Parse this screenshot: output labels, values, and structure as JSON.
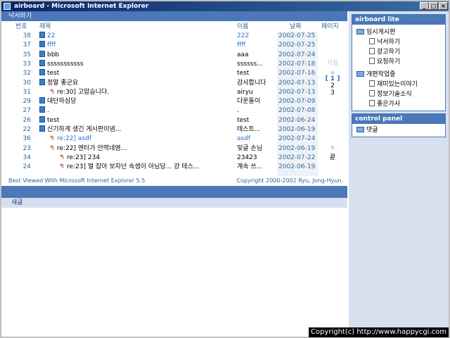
{
  "window": {
    "title": "airboard - Microsoft Internet Explorer"
  },
  "titlebar": {
    "min": "_",
    "max": "□",
    "close": "×"
  },
  "board": {
    "header": "낙서하기",
    "columns": {
      "num": "번호",
      "subject": "제목",
      "author": "이름",
      "date": "날짜",
      "page": "페이지"
    },
    "rows": [
      {
        "num": "38",
        "subject": "22",
        "author": "222",
        "date": "2002-07-25",
        "type": "doc",
        "indent": 0,
        "hl": true
      },
      {
        "num": "37",
        "subject": "ffff",
        "author": "ffff",
        "date": "2002-07-25",
        "type": "doc",
        "indent": 0,
        "hl": true
      },
      {
        "num": "35",
        "subject": "bbb",
        "author": "aaa",
        "date": "2002-07-24",
        "type": "doc",
        "indent": 0,
        "hl": false
      },
      {
        "num": "33",
        "subject": "sssssssssss",
        "author": "ssssss...",
        "date": "2002-07-18",
        "type": "doc",
        "indent": 0,
        "hl": false
      },
      {
        "num": "32",
        "subject": "test",
        "author": "test",
        "date": "2002-07-16",
        "type": "doc",
        "indent": 0,
        "hl": false
      },
      {
        "num": "30",
        "subject": "정말 좋군요",
        "author": "감사합니다",
        "date": "2002-07-13",
        "type": "doc",
        "indent": 0,
        "hl": false
      },
      {
        "num": "31",
        "subject": "re:30] 고맙습니다.",
        "author": "airyu",
        "date": "2002-07-13",
        "type": "reply",
        "indent": 1,
        "hl": false
      },
      {
        "num": "29",
        "subject": "대단하심당",
        "author": "다운돌이",
        "date": "2002-07-09",
        "type": "doc",
        "indent": 0,
        "hl": false
      },
      {
        "num": "27",
        "subject": ".",
        "author": ".",
        "date": "2002-07-08",
        "type": "doc",
        "indent": 0,
        "hl": false
      },
      {
        "num": "26",
        "subject": "test",
        "author": "test",
        "date": "2002-06-24",
        "type": "doc",
        "indent": 0,
        "hl": false
      },
      {
        "num": "22",
        "subject": "신기하게 생긴 게시판이넴...",
        "author": "테스트...",
        "date": "2002-06-19",
        "type": "doc",
        "indent": 0,
        "hl": false
      },
      {
        "num": "36",
        "subject": "re:22] asdf",
        "author": "asdf",
        "date": "2002-07-24",
        "type": "reply",
        "indent": 1,
        "hl": true
      },
      {
        "num": "23",
        "subject": "re:22] 엔터가 안먹네염...",
        "author": "잊글 손님",
        "date": "2002-06-19",
        "type": "reply",
        "indent": 1,
        "hl": false
      },
      {
        "num": "34",
        "subject": "re:23] 234",
        "author": "23423",
        "date": "2002-07-22",
        "type": "reply",
        "indent": 2,
        "hl": false
      },
      {
        "num": "24",
        "subject": "re:23] 멀 잡아 보자넌 속셈이 아님당... 걍 테스...",
        "author": "계속 쓰...",
        "date": "2002-06-19",
        "type": "reply",
        "indent": 2,
        "hl": false
      }
    ],
    "pager": {
      "first": "처음",
      "prev": "▲",
      "current": "[ 1 ]",
      "p2": "2",
      "p3": "3",
      "next": "▼",
      "last": "끝"
    },
    "footer_left": "Best Viewed With Microsoft Internet Explorer 5.5",
    "footer_right": "Copyright 2000-2002 Ryu, Jong-Hyun.",
    "new_post": "새글"
  },
  "sidebar": {
    "panel1": {
      "title": "airboard lite",
      "group1": "임시게시판",
      "items1": [
        "낙서하기",
        "광고하기",
        "요청하기"
      ],
      "group2": "개편작업중",
      "items2": [
        "재미있는이야기",
        "정보기술소식",
        "좋은가사"
      ]
    },
    "panel2": {
      "title": "control panel",
      "item": "댓글"
    }
  },
  "overlay": {
    "copyright": "Copyright(c) http://www.happycgi.com"
  },
  "colors": {
    "accent": "#4a78b8",
    "title_bar": "#0a246a",
    "link": "#336699"
  }
}
